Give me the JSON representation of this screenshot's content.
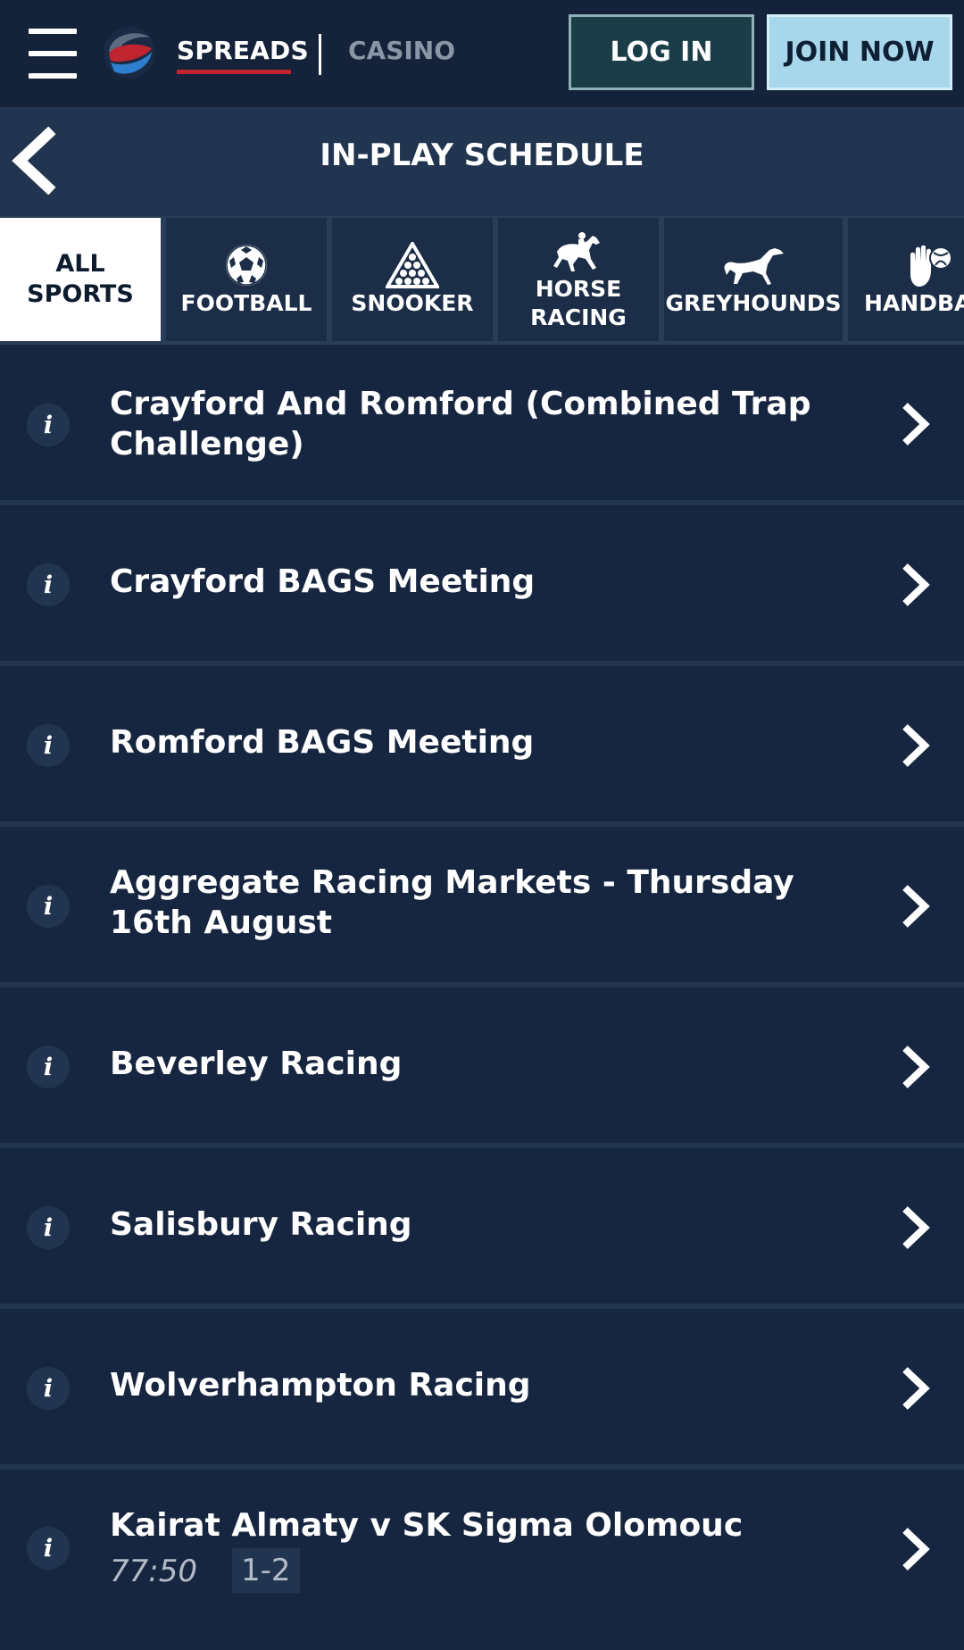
{
  "header": {
    "nav_spreads": "SPREADS",
    "nav_casino": "CASINO",
    "login_label": "LOG IN",
    "join_label": "JOIN NOW"
  },
  "titlebar": {
    "title": "IN-PLAY SCHEDULE"
  },
  "tabs": [
    {
      "label": "ALL SPORTS",
      "icon": "none",
      "active": true
    },
    {
      "label": "FOOTBALL",
      "icon": "football-icon",
      "active": false
    },
    {
      "label": "SNOOKER",
      "icon": "snooker-icon",
      "active": false
    },
    {
      "label": "HORSE RACING",
      "icon": "horse-racing-icon",
      "active": false
    },
    {
      "label": "GREYHOUNDS",
      "icon": "greyhound-icon",
      "active": false
    },
    {
      "label": "HANDBA",
      "icon": "handball-icon",
      "active": false
    }
  ],
  "events": [
    {
      "title": "Crayford And Romford (Combined Trap Challenge)"
    },
    {
      "title": "Crayford BAGS Meeting"
    },
    {
      "title": "Romford BAGS Meeting"
    },
    {
      "title": "Aggregate Racing Markets - Thursday 16th August"
    },
    {
      "title": "Beverley Racing"
    },
    {
      "title": "Salisbury Racing"
    },
    {
      "title": "Wolverhampton Racing"
    },
    {
      "title": "Kairat Almaty v SK Sigma Olomouc",
      "time": "77:50",
      "score": "1-2"
    }
  ],
  "colors": {
    "header_bg": "#14233a",
    "titlebar_bg": "#223550",
    "row_bg": "#172640",
    "brand_red": "#c0242f",
    "join_bg": "#a8d6ea",
    "login_bg": "#1b3d48"
  }
}
